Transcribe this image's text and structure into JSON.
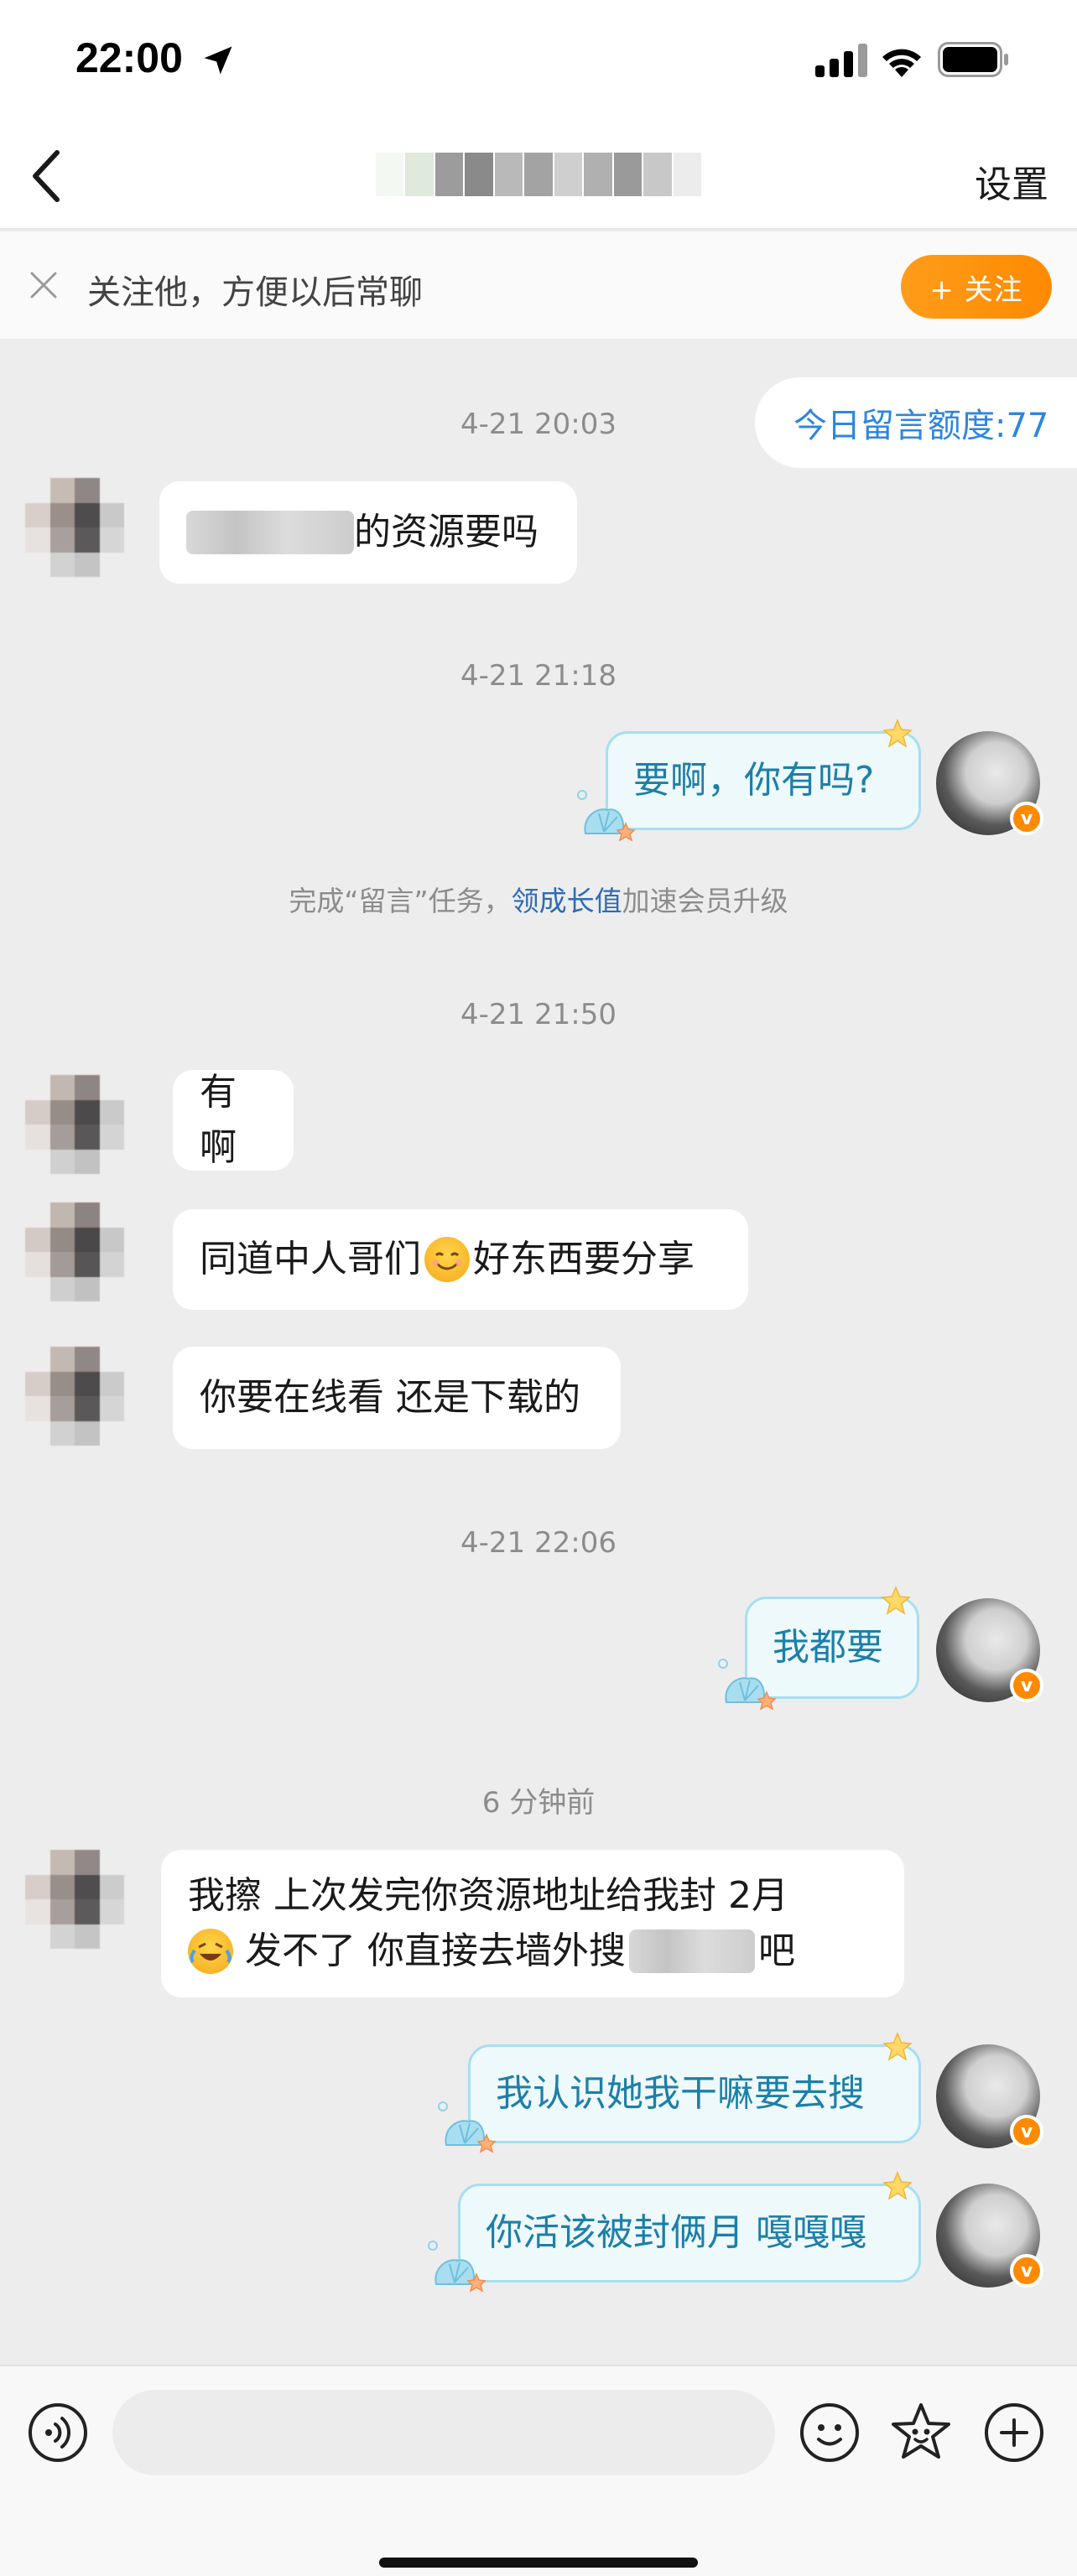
{
  "status_bar": {
    "time": "22:00"
  },
  "nav": {
    "settings_label": "设置"
  },
  "banner": {
    "text": "关注他，方便以后常聊",
    "follow_label": "+ 关注"
  },
  "chat": {
    "quota": "今日留言额度:77",
    "ts1": "4-21 20:03",
    "msg1_suffix": "的资源要吗",
    "ts2": "4-21 21:18",
    "msg2": "要啊，你有吗?",
    "notice_prefix": "完成“留言”任务，",
    "notice_link": "领成长值",
    "notice_suffix": "加速会员升级",
    "ts3": "4-21 21:50",
    "msg3": "有啊",
    "msg4_a": "同道中人哥们",
    "msg4_b": "好东西要分享",
    "msg5": "你要在线看 还是下载的",
    "ts4": "4-21 22:06",
    "msg6": "我都要",
    "ts5": "6 分钟前",
    "msg7_line1": "我擦 上次发完你资源地址给我封 2月",
    "msg7_line2_a": "发不了 你直接去墙外搜",
    "msg7_line2_b": "吧",
    "msg8": "我认识她我干嘛要去搜",
    "msg9": "你活该被封俩月 嘎嘎嘎"
  },
  "input": {
    "placeholder": ""
  },
  "colors": {
    "accent_orange": "#ff8a00",
    "bubble_out_text": "#1d7fa8",
    "bubble_out_border": "#a6dff0",
    "link_blue": "#2e6ab8"
  },
  "icons": [
    "location-arrow-icon",
    "signal-icon",
    "wifi-icon",
    "battery-icon",
    "back-chevron-icon",
    "close-icon",
    "voice-icon",
    "emoji-icon",
    "sticker-icon",
    "plus-icon",
    "verified-badge-icon"
  ]
}
